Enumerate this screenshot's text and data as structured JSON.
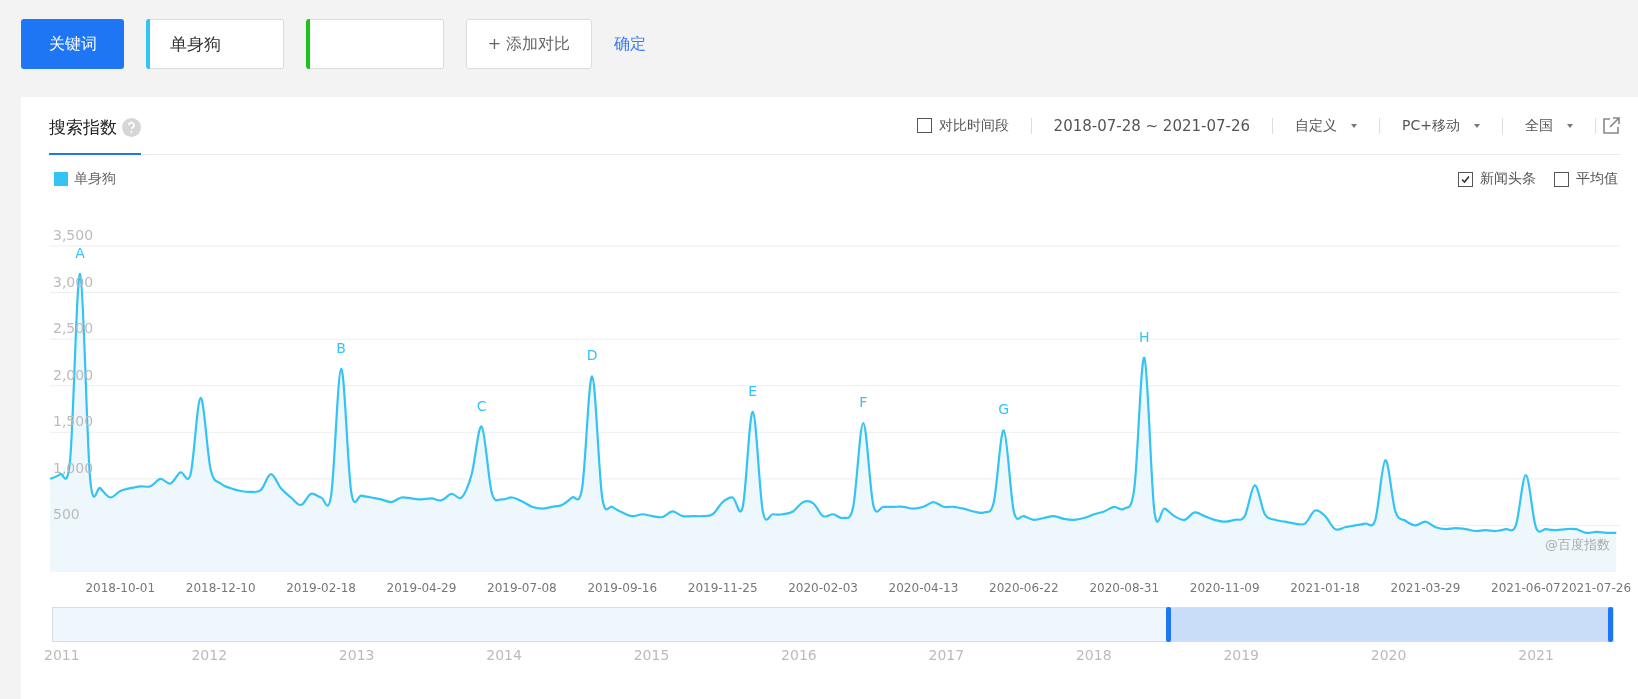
{
  "search_bar": {
    "mode_button": "关键词",
    "keywords": [
      {
        "value": "单身狗",
        "color": "#33c3f4"
      },
      {
        "color": "#1ec21e"
      }
    ],
    "add_button": "+ 添加对比",
    "confirm_link": "确定"
  },
  "panel": {
    "tabs": [
      {
        "label": "搜索指数",
        "selected": true
      }
    ],
    "controls": {
      "compare_period": {
        "label": "对比时间段",
        "checked": false
      },
      "date_range": "2018-07-28 ~ 2021-07-26",
      "dropdowns": [
        "自定义",
        "PC+移动",
        "全国"
      ]
    },
    "options": [
      {
        "label": "新闻头条",
        "checked": true
      },
      {
        "label": "平均值",
        "checked": false
      }
    ],
    "credit": "@百度指数",
    "chart_data": {
      "type": "area",
      "categories": [
        null,
        null,
        null,
        null,
        null,
        null,
        null,
        "2018-10-01",
        null,
        null,
        null,
        null,
        null,
        null,
        null,
        null,
        null,
        "2018-12-10",
        null,
        null,
        null,
        null,
        null,
        null,
        null,
        null,
        null,
        "2019-02-18",
        null,
        null,
        null,
        null,
        null,
        null,
        null,
        null,
        null,
        "2019-04-29",
        null,
        null,
        null,
        null,
        null,
        null,
        null,
        null,
        null,
        "2019-07-08",
        null,
        null,
        null,
        null,
        null,
        null,
        null,
        null,
        null,
        "2019-09-16",
        null,
        null,
        null,
        null,
        null,
        null,
        null,
        null,
        null,
        "2019-11-25",
        null,
        null,
        null,
        null,
        null,
        null,
        null,
        null,
        null,
        "2020-02-03",
        null,
        null,
        null,
        null,
        null,
        null,
        null,
        null,
        null,
        "2020-04-13",
        null,
        null,
        null,
        null,
        null,
        null,
        null,
        null,
        null,
        "2020-06-22",
        null,
        null,
        null,
        null,
        null,
        null,
        null,
        null,
        null,
        "2020-08-31",
        null,
        null,
        null,
        null,
        null,
        null,
        null,
        null,
        null,
        "2020-11-09",
        null,
        null,
        null,
        null,
        null,
        null,
        null,
        null,
        null,
        "2021-01-18",
        null,
        null,
        null,
        null,
        null,
        null,
        null,
        null,
        null,
        "2021-03-29",
        null,
        null,
        null,
        null,
        null,
        null,
        null,
        null,
        null,
        "2021-06-07",
        null,
        null,
        null,
        null,
        null,
        null,
        "2021-07-26",
        null,
        null
      ],
      "series": [
        {
          "name": "单身狗",
          "color": "#33c3f4",
          "values": [
            1000,
            1050,
            1200,
            3200,
            1000,
            900,
            800,
            870,
            900,
            920,
            920,
            1000,
            950,
            1070,
            1050,
            1870,
            1100,
            950,
            900,
            870,
            860,
            880,
            1050,
            900,
            800,
            720,
            840,
            800,
            820,
            2180,
            860,
            820,
            800,
            780,
            750,
            800,
            790,
            780,
            790,
            770,
            840,
            800,
            1050,
            1560,
            850,
            780,
            800,
            760,
            700,
            680,
            700,
            720,
            800,
            900,
            2100,
            800,
            700,
            640,
            600,
            620,
            600,
            590,
            650,
            600,
            600,
            600,
            620,
            750,
            800,
            700,
            1720,
            650,
            620,
            620,
            650,
            750,
            740,
            600,
            620,
            580,
            700,
            1600,
            720,
            700,
            700,
            700,
            680,
            700,
            750,
            700,
            700,
            680,
            650,
            640,
            750,
            1520,
            650,
            600,
            560,
            580,
            600,
            570,
            560,
            580,
            620,
            650,
            700,
            680,
            900,
            2300,
            650,
            680,
            600,
            560,
            640,
            600,
            560,
            540,
            560,
            600,
            930,
            620,
            560,
            540,
            520,
            520,
            660,
            600,
            460,
            480,
            500,
            520,
            560,
            1200,
            650,
            550,
            500,
            540,
            480,
            460,
            470,
            460,
            440,
            450,
            440,
            460,
            500,
            1040,
            480,
            460,
            450,
            460,
            460,
            420,
            430,
            420,
            420
          ]
        }
      ],
      "ylim": [
        0,
        3500
      ],
      "yticks": [
        {
          "value": 500,
          "label": "500"
        },
        {
          "value": 1000,
          "label": "1,000"
        },
        {
          "value": 1500,
          "label": "1,500"
        },
        {
          "value": 2000,
          "label": "2,000"
        },
        {
          "value": 2500,
          "label": "2,500"
        },
        {
          "value": 3000,
          "label": "3,000"
        },
        {
          "value": 3500,
          "label": "3,500"
        }
      ],
      "grid": true,
      "annotations": [
        {
          "y": 3200,
          "text": "A"
        },
        {
          "y": 2180,
          "text": "B"
        },
        {
          "y": 1560,
          "text": "C"
        },
        {
          "y": 2100,
          "text": "D"
        },
        {
          "y": 1720,
          "text": "E"
        },
        {
          "y": 1600,
          "text": "F"
        },
        {
          "y": 1520,
          "text": "G"
        },
        {
          "y": 2300,
          "text": "H"
        }
      ]
    },
    "navigator": {
      "years": [
        "2011",
        "2012",
        "2013",
        "2014",
        "2015",
        "2016",
        "2017",
        "2018",
        "2019",
        "2020",
        "2021"
      ],
      "handles": [
        {
          "level": 0.715
        },
        {
          "level": 0.998
        }
      ]
    }
  }
}
